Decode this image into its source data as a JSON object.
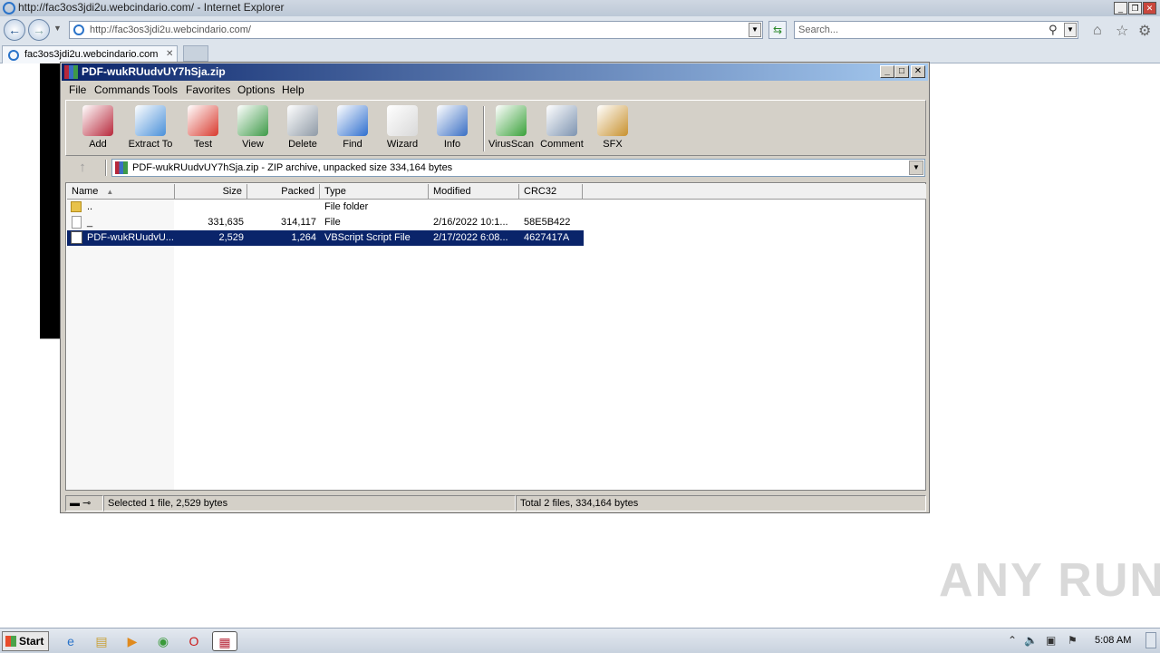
{
  "browser": {
    "title": "http://fac3os3jdi2u.webcindario.com/ - Internet Explorer",
    "url": "http://fac3os3jdi2u.webcindario.com/",
    "search_placeholder": "Search...",
    "tab_label": "fac3os3jdi2u.webcindario.com",
    "window_controls": [
      "_",
      "❐",
      "✕"
    ],
    "tab_close": "✕"
  },
  "winrar": {
    "title": "PDF-wukRUudvUY7hSja.zip",
    "window_controls": [
      "_",
      "□",
      "✕"
    ],
    "menu": [
      "File",
      "Commands",
      "Tools",
      "Favorites",
      "Options",
      "Help"
    ],
    "toolbar": [
      {
        "label": "Add",
        "icon": "add-books-icon",
        "color": "#b7283b"
      },
      {
        "label": "Extract To",
        "icon": "folder-icon",
        "color": "#4a90d9"
      },
      {
        "label": "Test",
        "icon": "clipboard-check-icon",
        "color": "#d93a2e"
      },
      {
        "label": "View",
        "icon": "book-icon",
        "color": "#3e9a48"
      },
      {
        "label": "Delete",
        "icon": "trash-icon",
        "color": "#8f9aa6"
      },
      {
        "label": "Find",
        "icon": "magnifier-icon",
        "color": "#2f6fcf"
      },
      {
        "label": "Wizard",
        "icon": "magic-wand-icon",
        "color": "#d9d9d9"
      },
      {
        "label": "Info",
        "icon": "info-icon",
        "color": "#3a6fc4"
      },
      {
        "label": "VirusScan",
        "icon": "bug-icon",
        "color": "#3aa13a"
      },
      {
        "label": "Comment",
        "icon": "comment-icon",
        "color": "#7d93b0"
      },
      {
        "label": "SFX",
        "icon": "box-icon",
        "color": "#c8912e"
      }
    ],
    "path": "PDF-wukRUudvUY7hSja.zip - ZIP archive, unpacked size 334,164 bytes",
    "columns": [
      "Name",
      "Size",
      "Packed",
      "Type",
      "Modified",
      "CRC32"
    ],
    "rows": [
      {
        "name": "..",
        "size": "",
        "packed": "",
        "type": "File folder",
        "modified": "",
        "crc": "",
        "icon": "folder-up-icon"
      },
      {
        "name": "_",
        "size": "331,635",
        "packed": "314,117",
        "type": "File",
        "modified": "2/16/2022 10:1...",
        "crc": "58E5B422",
        "icon": "file-icon"
      },
      {
        "name": "PDF-wukRUudvU...",
        "size": "2,529",
        "packed": "1,264",
        "type": "VBScript Script File",
        "modified": "2/17/2022 6:08...",
        "crc": "4627417A",
        "icon": "script-icon",
        "selected": true
      }
    ],
    "status_left": "Selected 1 file, 2,529 bytes",
    "status_right": "Total 2 files, 334,164 bytes"
  },
  "watermark": "ANY RUN",
  "taskbar": {
    "start_label": "Start",
    "clock": "5:08 AM"
  }
}
